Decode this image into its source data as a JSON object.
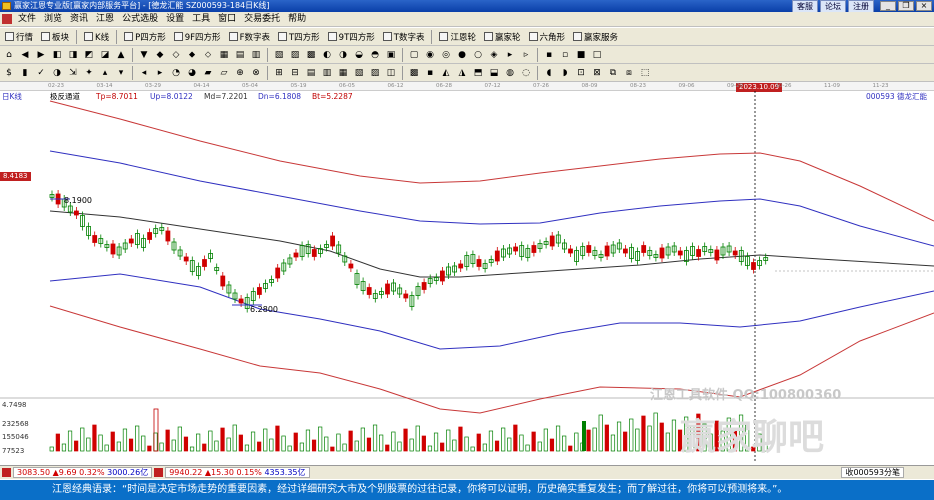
{
  "window": {
    "title": "赢家江恩专业版[赢家内部服务平台] - [德龙汇能  SZ000593-184日K线]",
    "title_buttons": [
      "客服",
      "论坛",
      "注册"
    ],
    "controls": [
      "_",
      "❐",
      "×"
    ]
  },
  "menu": [
    "文件",
    "浏览",
    "资讯",
    "江恩",
    "公式选股",
    "设置",
    "工具",
    "窗口",
    "交易委托",
    "帮助"
  ],
  "toolbar1": [
    "行情",
    "板块",
    "K线",
    "P四方形",
    "9F四方形",
    "F数字表",
    "T四方形",
    "9T四方形",
    "T数字表",
    "江恩轮",
    "赢家轮",
    "六角形",
    "赢家服务"
  ],
  "toolbar1_icons": [
    "market-icon",
    "sector-icon",
    "kline-icon",
    "p-square-icon",
    "nine-f-square-icon",
    "f-table-icon",
    "t-square-icon",
    "nine-t-square-icon",
    "t-table-icon",
    "gann-wheel-icon",
    "winner-wheel-icon",
    "hexagon-icon",
    "service-icon"
  ],
  "dates": [
    "02-23",
    "03-14",
    "03-29",
    "04-14",
    "05-04",
    "05-19",
    "06-05",
    "06-12",
    "06-28",
    "07-12",
    "07-26",
    "08-09",
    "08-23",
    "09-06",
    "09-20",
    "10-26",
    "11-09",
    "11-23"
  ],
  "date_highlight": "2023.10.09",
  "chart_label": "日K线",
  "indicator": {
    "name": "极反通道",
    "tp": "Tp=8.7011",
    "up": "Up=8.0122",
    "md": "Md=7.2201",
    "dn": "Dn=6.1808",
    "bt": "Bt=5.2287",
    "stock": "000593 德龙汇能"
  },
  "price_marker": "8.4183",
  "annotations": {
    "high": "8.1900",
    "low": "6.2800"
  },
  "volume_axis": [
    "4.7498",
    "232568",
    "155046",
    "77523"
  ],
  "watermark": {
    "line1": "江恩工具软件  QQ:100800360",
    "line2": "赢家聊吧"
  },
  "colors": {
    "up": "#008000",
    "down": "#d00000",
    "upper_band": "#c83838",
    "mid_band": "#3030c0",
    "md_line": "#333333"
  },
  "status": {
    "sh_index": "3083.50",
    "sh_change": "▲9.69",
    "sh_pct": "0.32%",
    "sh_amount": "3000.26亿",
    "sz_index": "9940.22",
    "sz_change": "▲15.30",
    "sz_pct": "0.15%",
    "sz_amount": "4353.35亿",
    "right": "收000593分笔"
  },
  "ticker": "江恩经典语录：“时间是决定市场走势的重要因素，经过详细研究大市及个别股票的过往记录，你将可以证明，历史确实重复发生；而了解过往，你将可以预测将来。”。"
}
